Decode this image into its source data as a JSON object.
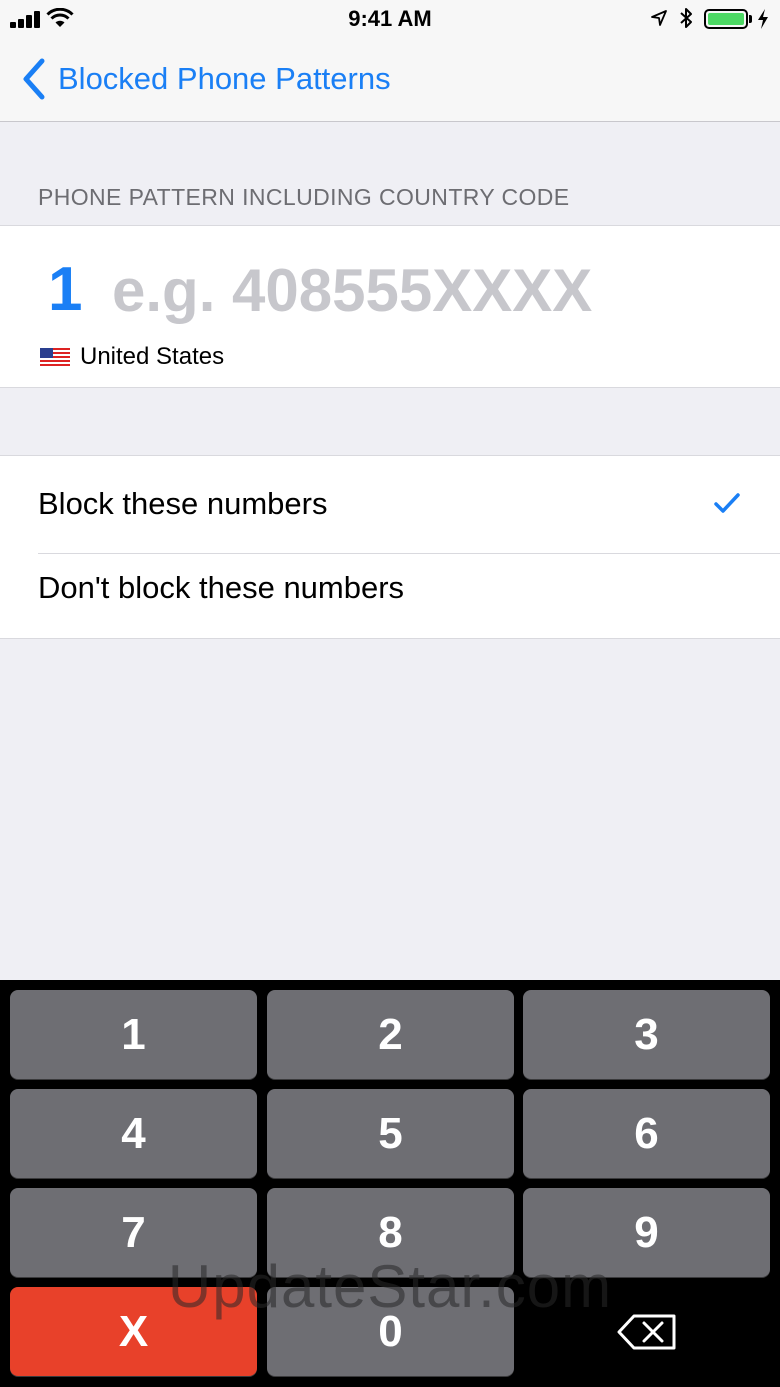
{
  "status_bar": {
    "time": "9:41 AM"
  },
  "nav": {
    "back_label": "Blocked Phone Patterns"
  },
  "section": {
    "header": "PHONE PATTERN INCLUDING COUNTRY CODE"
  },
  "pattern": {
    "country_code": "1",
    "placeholder": "e.g. 408555XXXX",
    "value": "",
    "country_name": "United States"
  },
  "options": [
    {
      "label": "Block these numbers",
      "selected": true
    },
    {
      "label": "Don't block these numbers",
      "selected": false
    }
  ],
  "keypad": {
    "keys": [
      "1",
      "2",
      "3",
      "4",
      "5",
      "6",
      "7",
      "8",
      "9",
      "X",
      "0"
    ],
    "clear_color": "#e8412a",
    "key_color": "#6e6e73"
  },
  "watermark": "UpdateStar.com",
  "colors": {
    "accent": "#1a7ff5",
    "battery": "#4cd964"
  }
}
